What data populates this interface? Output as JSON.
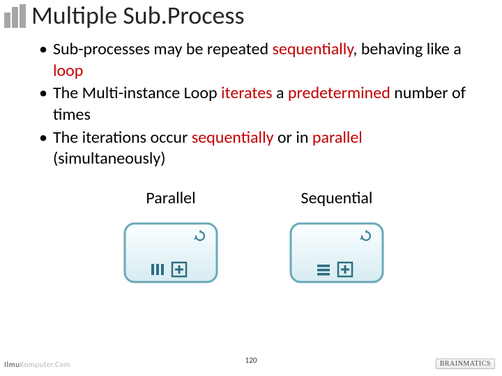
{
  "title": "Multiple Sub.Process",
  "bullets": [
    {
      "pre": "Sub-processes may be repeated ",
      "em1": "sequentially",
      "mid": ", behaving like a ",
      "em2": "loop",
      "post": ""
    },
    {
      "pre": "The Multi-instance Loop ",
      "em1": "iterates",
      "mid": " a ",
      "em2": "predetermined",
      "post": " number of times"
    },
    {
      "pre": "The iterations occur ",
      "em1": "sequentially",
      "mid": " or in ",
      "em2": "parallel",
      "post": " (simultaneously)"
    }
  ],
  "diagrams": {
    "parallel": {
      "label": "Parallel"
    },
    "sequential": {
      "label": "Sequential"
    }
  },
  "page_number": "120",
  "footer_left": {
    "a": "Ilmu",
    "b": "Komputer",
    "c": ".Com"
  },
  "footer_right": "BRAINMATICS"
}
